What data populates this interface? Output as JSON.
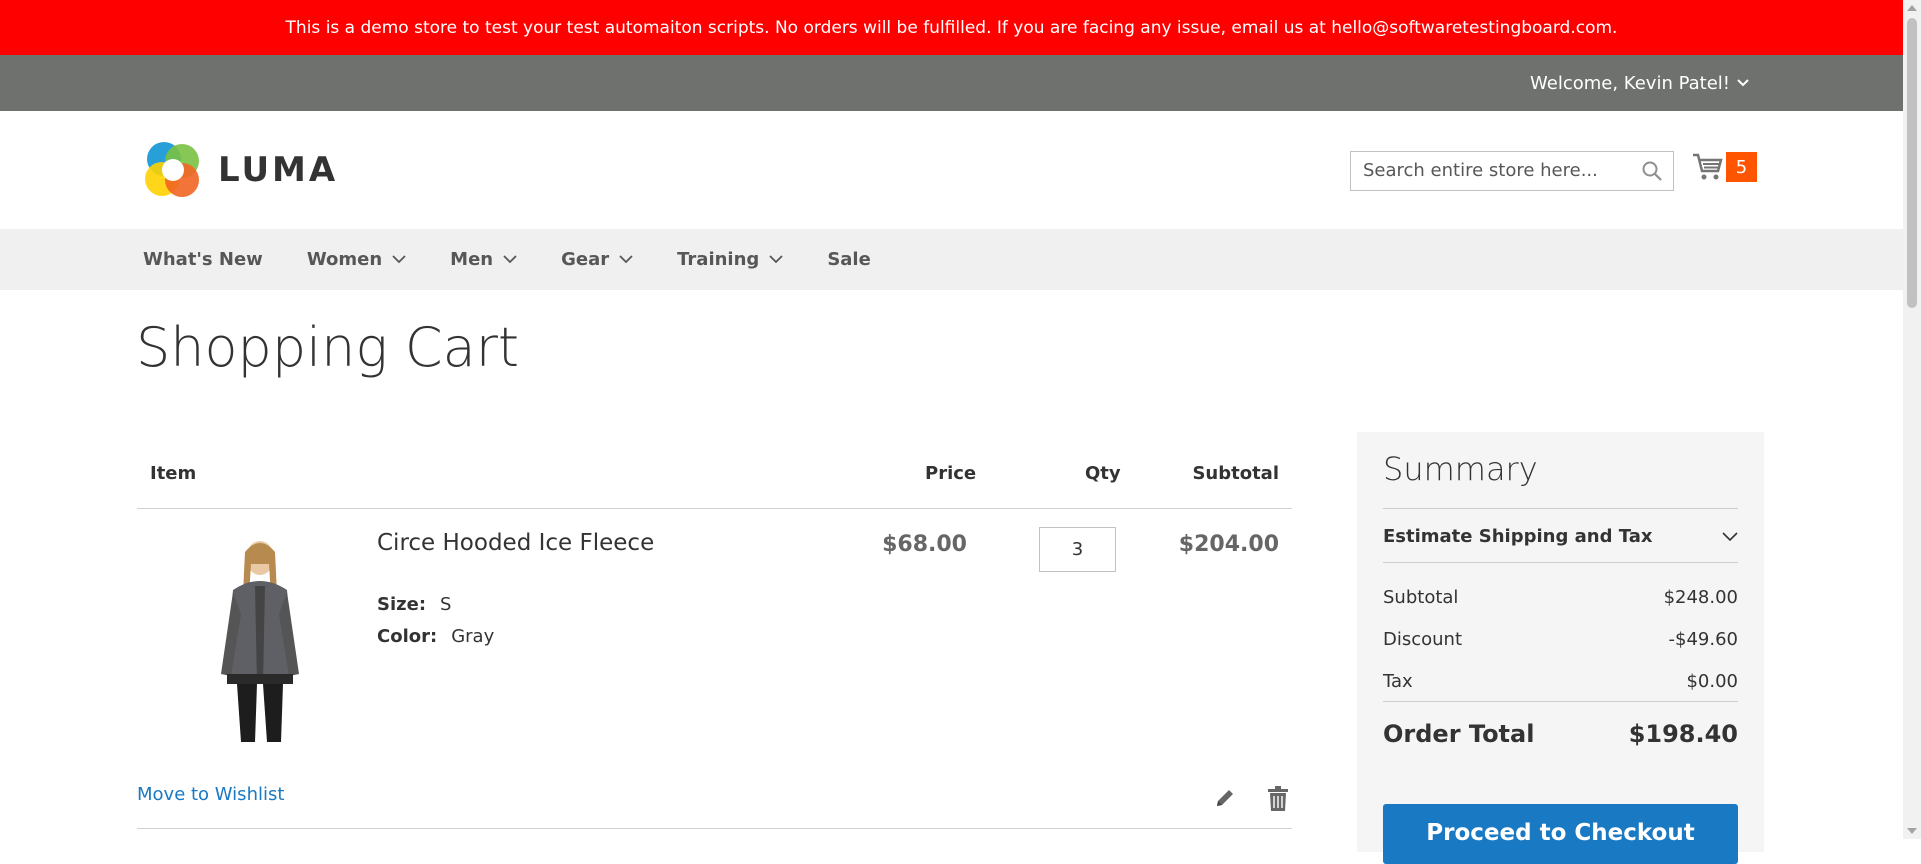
{
  "banner": {
    "text": "This is a demo store to test your test automaiton scripts. No orders will be fulfilled. If you are facing any issue, email us at hello@softwaretestingboard.com."
  },
  "topbar": {
    "welcome": "Welcome, Kevin Patel!"
  },
  "header": {
    "logo_text": "LUMA",
    "search_placeholder": "Search entire store here...",
    "cart_count": "5"
  },
  "nav": {
    "items": [
      {
        "label": "What's New",
        "has_dropdown": false
      },
      {
        "label": "Women",
        "has_dropdown": true
      },
      {
        "label": "Men",
        "has_dropdown": true
      },
      {
        "label": "Gear",
        "has_dropdown": true
      },
      {
        "label": "Training",
        "has_dropdown": true
      },
      {
        "label": "Sale",
        "has_dropdown": false
      }
    ]
  },
  "page_title": "Shopping Cart",
  "cart": {
    "headers": {
      "item": "Item",
      "price": "Price",
      "qty": "Qty",
      "subtotal": "Subtotal"
    },
    "items": [
      {
        "name": "Circe Hooded Ice Fleece",
        "size_label": "Size:",
        "size": "S",
        "color_label": "Color:",
        "color": "Gray",
        "price": "$68.00",
        "qty": "3",
        "subtotal": "$204.00",
        "wishlist_label": "Move to Wishlist"
      }
    ]
  },
  "summary": {
    "title": "Summary",
    "estimate_label": "Estimate Shipping and Tax",
    "rows": [
      {
        "label": "Subtotal",
        "value": "$248.00"
      },
      {
        "label": "Discount",
        "value": "-$49.60"
      },
      {
        "label": "Tax",
        "value": "$0.00"
      }
    ],
    "total_label": "Order Total",
    "total_value": "$198.40",
    "checkout_label": "Proceed to Checkout"
  },
  "colors": {
    "banner": "#ff0000",
    "topbar": "#6e716e",
    "link": "#1979c3",
    "cart_badge": "#ff5501"
  }
}
